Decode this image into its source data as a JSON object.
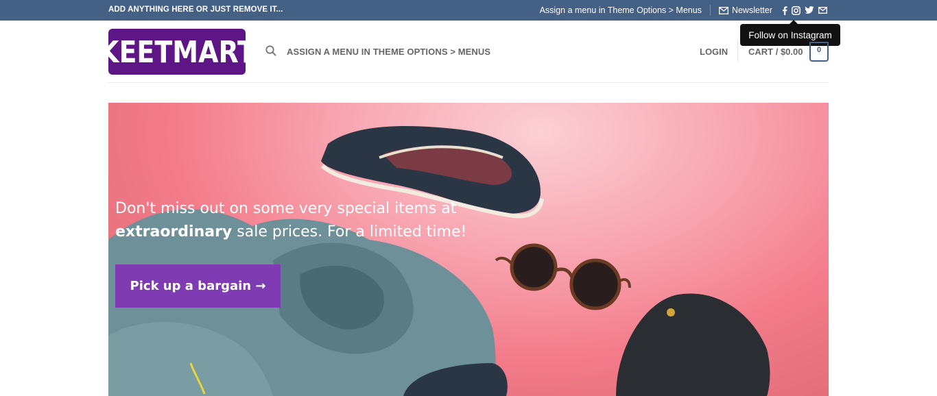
{
  "topbar": {
    "left_text": "ADD ANYTHING HERE OR JUST REMOVE IT...",
    "menu_link": "Assign a menu in Theme Options > Menus",
    "newsletter": "Newsletter",
    "social_icons": [
      "facebook-icon",
      "instagram-icon",
      "twitter-icon",
      "email-icon"
    ]
  },
  "tooltip": {
    "text": "Follow on Instagram"
  },
  "header": {
    "logo_text": "KEETMART",
    "main_menu": "ASSIGN A MENU IN THEME OPTIONS > MENUS",
    "login": "LOGIN",
    "cart": "CART / $0.00",
    "cart_count": "0"
  },
  "hero": {
    "line1": "Don't miss out on some very special items at",
    "line2_bold": "extraordinary",
    "line2_rest": " sale prices. For a limited time!",
    "button": "Pick up a bargain →"
  },
  "colors": {
    "topbar_bg": "#446084",
    "logo_bg": "#5e1585",
    "button_bg": "#7e3bb2",
    "hero_bg": "#f47c8a"
  }
}
